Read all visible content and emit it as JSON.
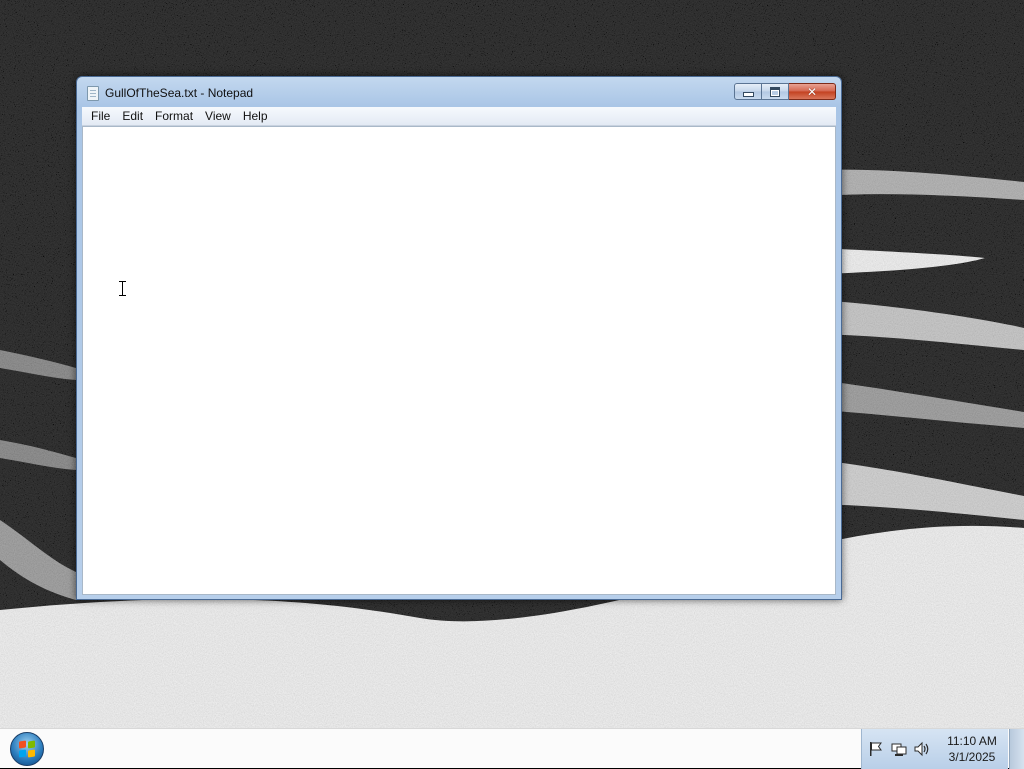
{
  "window": {
    "title": "GullOfTheSea.txt - Notepad",
    "buttons": {
      "minimize": "minimize",
      "maximize": "maximize",
      "close": "close"
    }
  },
  "menu": {
    "items": [
      {
        "label": "File"
      },
      {
        "label": "Edit"
      },
      {
        "label": "Format"
      },
      {
        "label": "View"
      },
      {
        "label": "Help"
      }
    ]
  },
  "editor": {
    "content": ""
  },
  "taskbar": {
    "clock": {
      "time": "11:10 AM",
      "date": "3/1/2025"
    },
    "tray_icons": [
      "action-center-flag-icon",
      "network-icon",
      "volume-icon"
    ]
  },
  "colors": {
    "titlebar": "#b7cfeb",
    "close_button": "#c3401f",
    "taskbar": "#fbfbfb",
    "desktop_background": "#000000"
  }
}
